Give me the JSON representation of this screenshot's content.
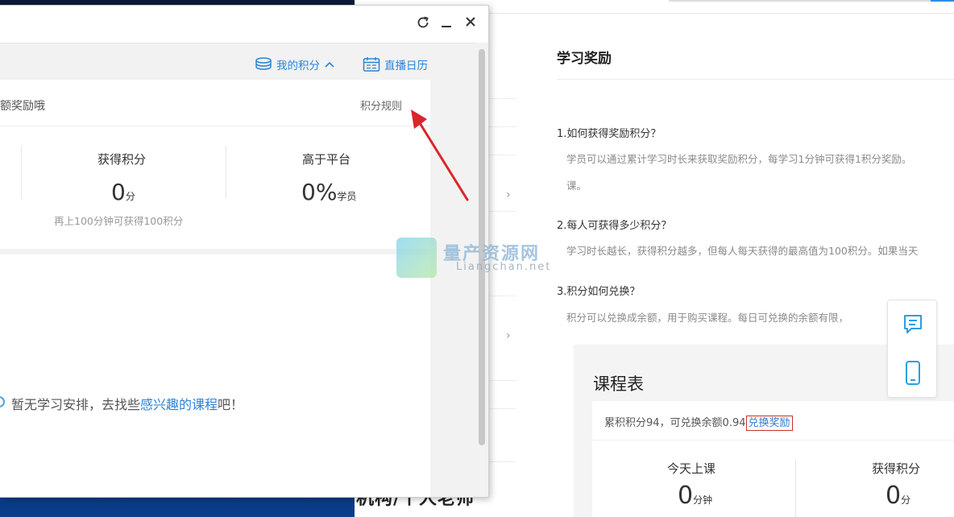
{
  "popup": {
    "toolbar": {
      "my_points": "我的积分",
      "live_calendar": "直播日历"
    },
    "card": {
      "info_text": "额奖励哦",
      "rules_link": "积分规则",
      "stats": [
        {
          "label": "获得积分",
          "value": "0",
          "unit": "分"
        },
        {
          "label": "高于平台",
          "value": "0%",
          "unit": "学员"
        }
      ],
      "hint": "再上100分钟可获得100积分"
    },
    "empty": {
      "prefix": "暂无学习安排，去找些",
      "link": "感兴趣的课程",
      "suffix": "吧！"
    }
  },
  "page": {
    "rewards_title": "学习奖励",
    "faq": [
      {
        "q": "1.如何获得奖励积分？",
        "a": "学员可以通过累计学习时长来获取奖励积分，每学习1分钟可获得1积分奖励。",
        "a_cont": "课。"
      },
      {
        "q": "2.每人可获得多少积分？",
        "a": "学习时长越长，获得积分越多，但每人每天获得的最高值为100积分。如果当天"
      },
      {
        "q": "3.积分如何兑换？",
        "a": "积分可以兑换成余额，用于购买课程。每日可兑换的余额有限，"
      }
    ],
    "bottom_heading": "机构/个人老师",
    "schedule": {
      "title": "课程表",
      "summary": "累积积分94，可兑换余额0.94",
      "exchange_link": "兑换奖励",
      "stats": [
        {
          "label": "今天上课",
          "value": "0",
          "unit": "分钟"
        },
        {
          "label": "获得积分",
          "value": "0",
          "unit": "分"
        }
      ]
    }
  },
  "watermark": {
    "title": "量产资源网",
    "subtitle": "Liangchan.net"
  },
  "colors": {
    "accent": "#2a84d8",
    "annotation": "#d9262a"
  }
}
